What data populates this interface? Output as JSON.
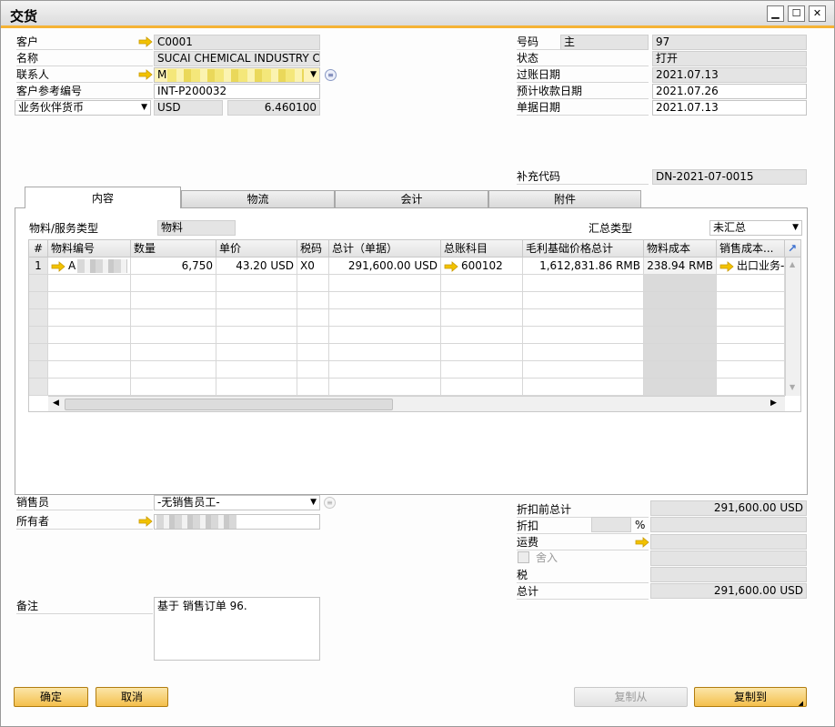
{
  "window": {
    "title": "交货"
  },
  "header_left": {
    "customer_label": "客户",
    "customer_value": "C0001",
    "name_label": "名称",
    "name_value": "SUCAI CHEMICAL INDUSTRY CO",
    "contact_label": "联系人",
    "contact_value": "M",
    "cust_ref_label": "客户参考编号",
    "cust_ref_value": "INT-P200032",
    "currency_label": "业务伙伴货币",
    "currency_value": "USD",
    "rate_value": "6.460100"
  },
  "header_right": {
    "number_label": "号码",
    "series_value": "主",
    "number_value": "97",
    "status_label": "状态",
    "status_value": "打开",
    "posting_date_label": "过账日期",
    "posting_date_value": "2021.07.13",
    "due_date_label": "预计收款日期",
    "due_date_value": "2021.07.26",
    "doc_date_label": "单据日期",
    "doc_date_value": "2021.07.13",
    "supp_code_label": "补充代码",
    "supp_code_value": "DN-2021-07-0015"
  },
  "tabs": [
    {
      "label": "内容"
    },
    {
      "label": "物流"
    },
    {
      "label": "会计"
    },
    {
      "label": "附件"
    }
  ],
  "contents": {
    "item_type_label": "物料/服务类型",
    "item_type_value": "物料",
    "summary_type_label": "汇总类型",
    "summary_type_value": "未汇总"
  },
  "grid": {
    "headers": [
      "#",
      "物料编号",
      "数量",
      "单价",
      "税码",
      "总计（单据）",
      "总账科目",
      "毛利基础价格总计",
      "物料成本",
      "销售成本..."
    ],
    "rows": [
      {
        "num": "1",
        "item": "A",
        "qty": "6,750",
        "price": "43.20 USD",
        "tax": "X0",
        "total": "291,600.00 USD",
        "gl": "600102",
        "gross": "1,612,831.86 RMB",
        "cost": "238.94 RMB",
        "cogs": "出口业务-"
      }
    ]
  },
  "footer_left": {
    "sales_emp_label": "销售员",
    "sales_emp_value": "-无销售员工-",
    "owner_label": "所有者",
    "remarks_label": "备注",
    "remarks_value": "基于 销售订单 96."
  },
  "footer_right": {
    "before_disc_label": "折扣前总计",
    "before_disc_value": "291,600.00 USD",
    "discount_label": "折扣",
    "percent_sign": "%",
    "freight_label": "运费",
    "rounding_label": "舍入",
    "tax_label": "税",
    "total_label": "总计",
    "total_value": "291,600.00 USD"
  },
  "buttons": {
    "ok": "确定",
    "cancel": "取消",
    "copy_from": "复制从",
    "copy_to": "复制到"
  },
  "colors": {
    "accent": "#f5b335",
    "button_top": "#fbe6a9",
    "button_bottom": "#f4bf4c",
    "link_arrow": "#f2c200"
  }
}
